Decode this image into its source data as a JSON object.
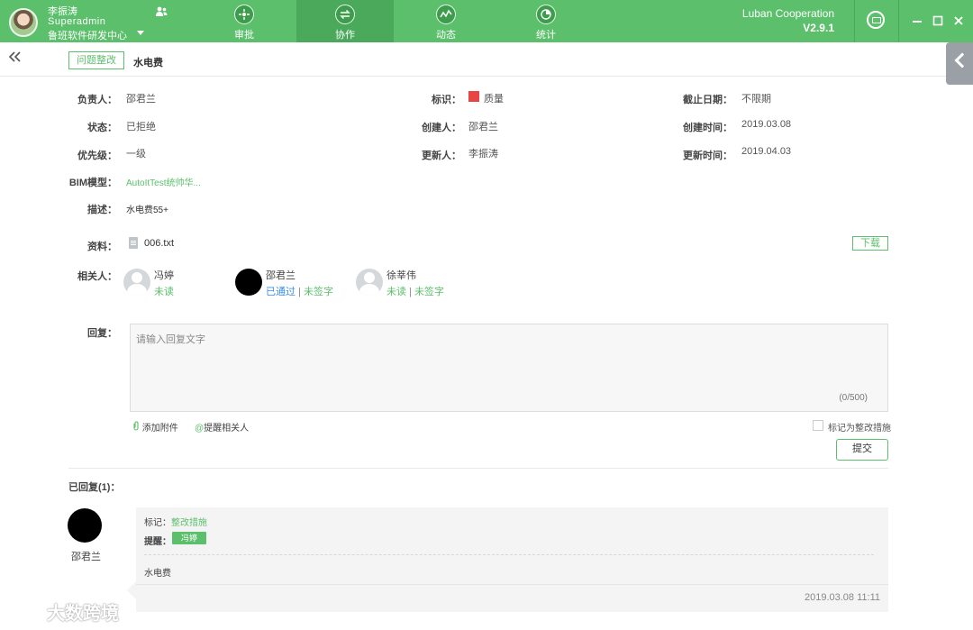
{
  "topbar": {
    "user_name": "李振涛",
    "user_role": "Superadmin",
    "user_org": "鲁班软件研发中心",
    "nav": [
      {
        "label": "审批",
        "icon": "approval-icon"
      },
      {
        "label": "协作",
        "icon": "collaboration-icon"
      },
      {
        "label": "动态",
        "icon": "activity-icon"
      },
      {
        "label": "统计",
        "icon": "statistics-icon"
      }
    ],
    "brand_name": "Luban Cooperation",
    "brand_version": "V2.9.1",
    "colors": {
      "primary": "#5cbf6c",
      "active": "#4aa95a"
    }
  },
  "subheader": {
    "category_tag": "问题整改",
    "title": "水电费"
  },
  "fields": {
    "owner_label": "负责人：",
    "owner": "邵君兰",
    "mark_label": "标识：",
    "mark": "质量",
    "mark_color": "#e84545",
    "deadline_label": "截止日期：",
    "deadline": "不限期",
    "status_label": "状态：",
    "status": "已拒绝",
    "creator_label": "创建人：",
    "creator": "邵君兰",
    "created_label": "创建时间：",
    "created": "2019.03.08",
    "priority_label": "优先级：",
    "priority": "一级",
    "updater_label": "更新人：",
    "updater": "李振涛",
    "updated_label": "更新时间：",
    "updated": "2019.04.03",
    "bim_label": "BIM模型：",
    "bim": "AutoItTest统帅华...",
    "desc_label": "描述：",
    "desc": "水电费55+",
    "file_label": "资料：",
    "file_name": "006.txt",
    "download": "下载",
    "related_label": "相关人："
  },
  "related": [
    {
      "name": "冯婷",
      "status1": "未读",
      "status2": ""
    },
    {
      "name": "邵君兰",
      "status1": "已通过",
      "status2": "未签字"
    },
    {
      "name": "徐莘伟",
      "status1": "未读",
      "status2": "未签字"
    }
  ],
  "reply": {
    "label": "回复：",
    "placeholder": "请输入回复文字",
    "counter": "(0/500)",
    "attach": "添加附件",
    "mention": "提醒相关人",
    "mark_as_measure": "标记为整改措施",
    "submit": "提交"
  },
  "replied": {
    "header": "已回复(1)：",
    "items": [
      {
        "author": "邵君兰",
        "mark_label": "标记：",
        "mark_value": "整改措施",
        "remind_label": "提醒：",
        "remind_chip": "冯婷",
        "body": "水电费",
        "time": "2019.03.08 11:11"
      }
    ]
  },
  "watermark": "大数跨境"
}
